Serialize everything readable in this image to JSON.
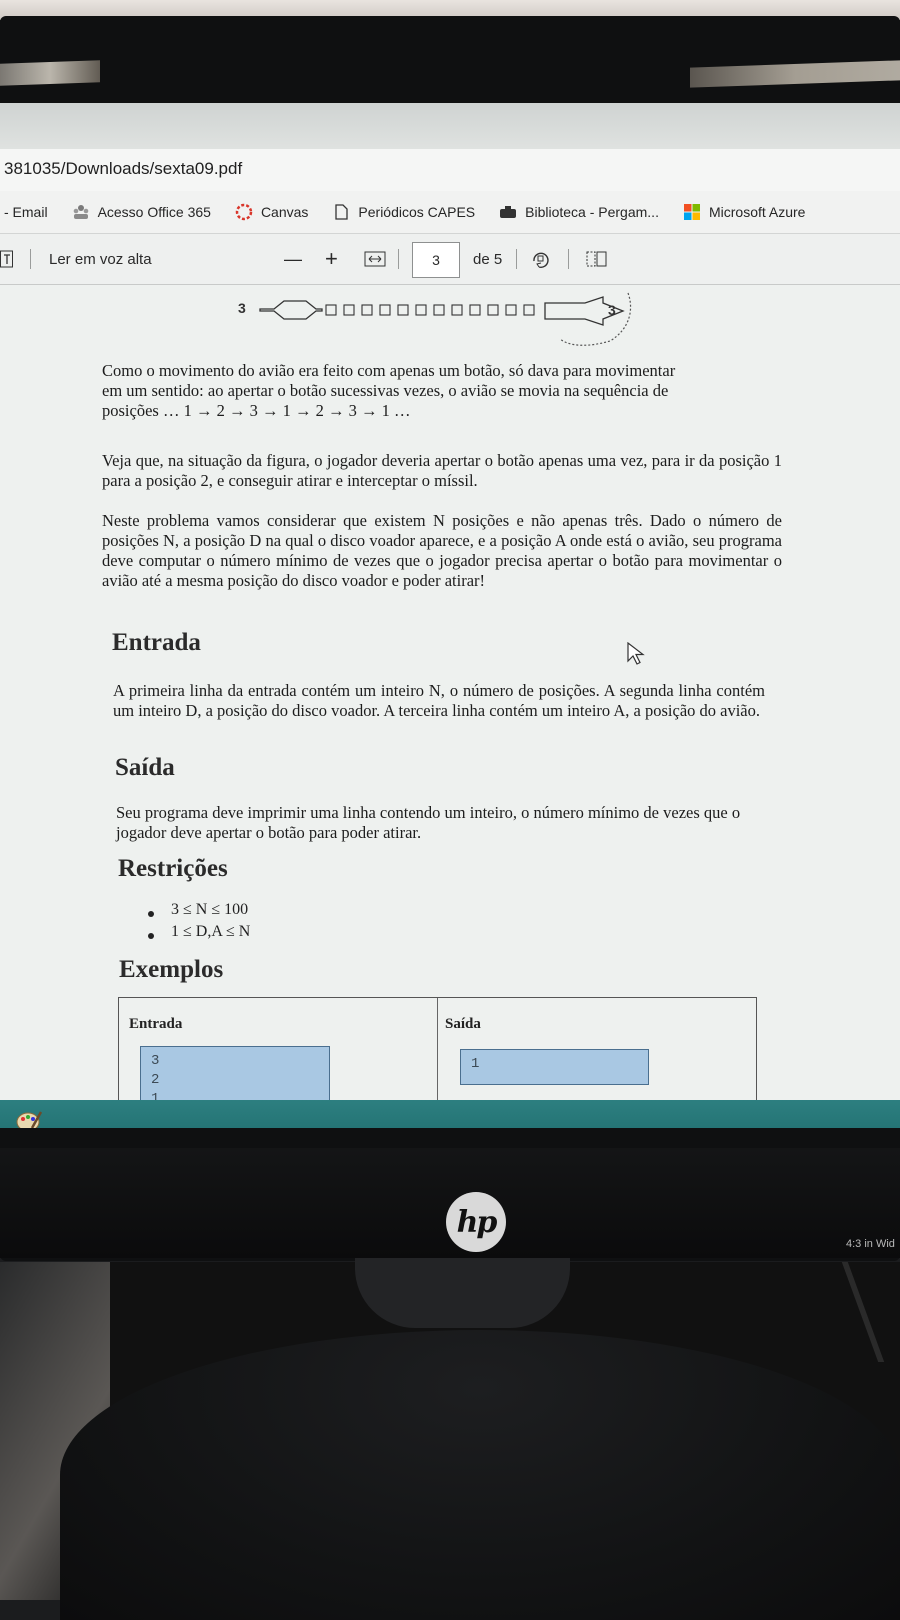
{
  "browser": {
    "url": "381035/Downloads/sexta09.pdf",
    "bookmarks": [
      {
        "label": "- Email",
        "icon": "email-icon"
      },
      {
        "label": "Acesso Office 365",
        "icon": "office-people-icon"
      },
      {
        "label": "Canvas",
        "icon": "canvas-icon"
      },
      {
        "label": "Periódicos CAPES",
        "icon": "document-icon"
      },
      {
        "label": "Biblioteca - Pergam...",
        "icon": "library-icon"
      },
      {
        "label": "Microsoft Azure",
        "icon": "microsoft-icon"
      }
    ]
  },
  "pdf_toolbar": {
    "read_aloud": "Ler em voz alta",
    "zoom_out": "—",
    "zoom_in": "+",
    "page_current": "3",
    "page_total": "de 5"
  },
  "figure": {
    "left_number": "3",
    "right_number": "3"
  },
  "document": {
    "p1_line1": "Como o movimento do avião era feito com apenas um botão, só dava para movimentar",
    "p1_line2": "em um sentido: ao apertar o botão sucessivas vezes, o avião se movia na sequência de",
    "p1_line3": "posições … 1 → 2 → 3 → 1 → 2 → 3 → 1 …",
    "p2": "Veja que, na situação da figura, o jogador deveria apertar o botão apenas uma vez, para ir da posição 1 para a posição 2, e conseguir atirar e interceptar o míssil.",
    "p3": "Neste problema vamos considerar que existem N posições e não apenas três. Dado o número de posições N, a posição D na qual o disco voador aparece, e a posição A onde está o avião, seu programa deve computar o número mínimo de vezes que o jogador precisa apertar o botão para movimentar o avião até a mesma posição do disco voador e poder atirar!",
    "h_entrada": "Entrada",
    "entrada_text": "A primeira linha da entrada contém um inteiro N, o número de posições. A segunda linha contém um inteiro D, a posição do disco voador. A terceira linha contém um inteiro A, a posição do avião.",
    "h_saida": "Saída",
    "saida_text": "Seu programa deve imprimir uma linha contendo um inteiro, o número mínimo de vezes que o jogador deve apertar o botão para poder atirar.",
    "h_restricoes": "Restrições",
    "restricoes": [
      "3 ≤ N ≤ 100",
      "1 ≤ D,A ≤ N"
    ],
    "h_exemplos": "Exemplos",
    "table_headers": [
      "Entrada",
      "Saída"
    ],
    "example_input": [
      "3",
      "2",
      "1"
    ],
    "example_output": "1"
  },
  "monitor": {
    "brand": "hp",
    "aspect_label": "4:3 in Wid"
  }
}
